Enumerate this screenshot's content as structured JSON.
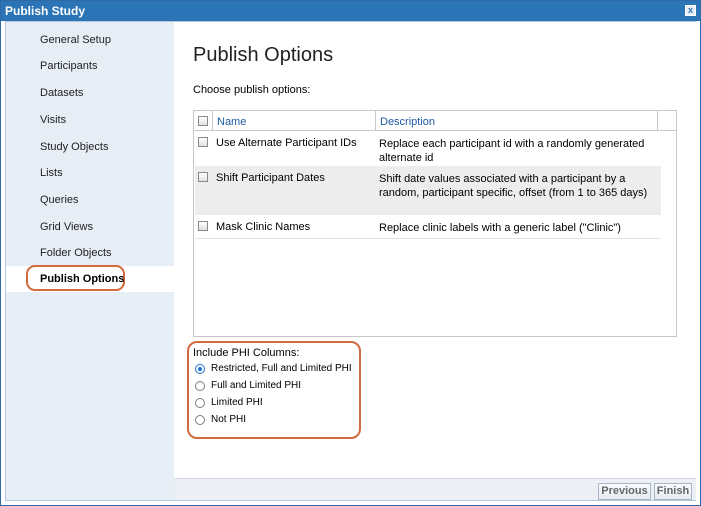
{
  "dialog": {
    "title": "Publish Study",
    "close_glyph": "x"
  },
  "sidebar": {
    "items": [
      {
        "label": "General Setup"
      },
      {
        "label": "Participants"
      },
      {
        "label": "Datasets"
      },
      {
        "label": "Visits"
      },
      {
        "label": "Study Objects"
      },
      {
        "label": "Lists"
      },
      {
        "label": "Queries"
      },
      {
        "label": "Grid Views"
      },
      {
        "label": "Folder Objects"
      },
      {
        "label": "Publish Options"
      }
    ],
    "active_index": 9
  },
  "main": {
    "title": "Publish Options",
    "instruction": "Choose publish options:",
    "grid": {
      "columns": [
        {
          "label": "Name"
        },
        {
          "label": "Description"
        }
      ],
      "rows": [
        {
          "name": "Use Alternate Participant IDs",
          "description": "Replace each participant id with a randomly generated alternate id",
          "checked": false
        },
        {
          "name": "Shift Participant Dates",
          "description": "Shift date values associated with a participant by a random, participant specific, offset (from 1 to 365 days)",
          "checked": false
        },
        {
          "name": "Mask Clinic Names",
          "description": "Replace clinic labels with a generic label (\"Clinic\")",
          "checked": false
        }
      ]
    },
    "phi": {
      "label": "Include PHI Columns:",
      "options": [
        {
          "label": "Restricted, Full and Limited PHI",
          "selected": true
        },
        {
          "label": "Full and Limited PHI",
          "selected": false
        },
        {
          "label": "Limited PHI",
          "selected": false
        },
        {
          "label": "Not PHI",
          "selected": false
        }
      ]
    }
  },
  "footer": {
    "previous_label": "Previous",
    "finish_label": "Finish"
  },
  "colors": {
    "titlebar": "#2b75b7",
    "highlight": "#d16a3f",
    "sidebar": "#e7eef6",
    "link": "#1f5aa0"
  }
}
